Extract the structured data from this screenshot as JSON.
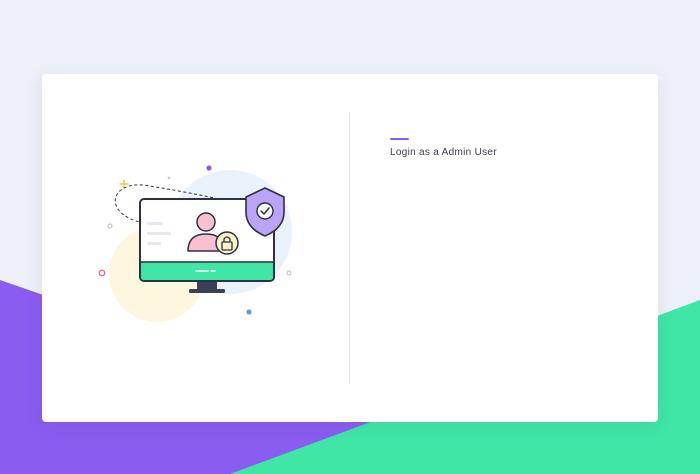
{
  "colors": {
    "page_background": "#edf0f7",
    "purple_band": "#8b5cf0",
    "green_band": "#3fe6a6",
    "accent": "#8b5cf0",
    "title_text": "#3a3a4a"
  },
  "illustration": {
    "monitor_icon": "monitor-icon",
    "user_icon": "user-icon",
    "lock_icon": "lock-icon",
    "shield_icon": "shield-check-icon"
  },
  "login": {
    "title": "Login as a Admin User"
  }
}
